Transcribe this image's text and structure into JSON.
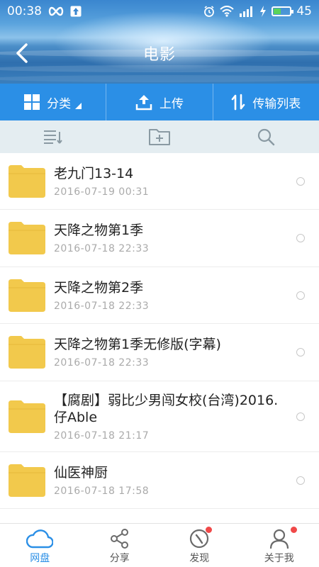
{
  "status_bar": {
    "time": "00:38",
    "battery_level": "45",
    "battery_fraction": 0.45,
    "battery_color": "#5ad35a"
  },
  "header": {
    "title": "电影"
  },
  "action_bar": {
    "category_label": "分类",
    "upload_label": "上传",
    "transfer_label": "传输列表"
  },
  "files": [
    {
      "name": "老九门13-14",
      "date": "2016-07-19   00:31"
    },
    {
      "name": "天降之物第1季",
      "date": "2016-07-18   22:33"
    },
    {
      "name": "天降之物第2季",
      "date": "2016-07-18   22:33"
    },
    {
      "name": "天降之物第1季无修版(字幕)",
      "date": "2016-07-18   22:33"
    },
    {
      "name": "【腐剧】弱比少男闯女校(台湾)2016.仔Able",
      "date": "2016-07-18   21:17"
    },
    {
      "name": "仙医神厨",
      "date": "2016-07-18   17:58"
    }
  ],
  "bottom_nav": [
    {
      "label": "网盘",
      "icon": "cloud-icon",
      "active": true
    },
    {
      "label": "分享",
      "icon": "share-icon",
      "active": false
    },
    {
      "label": "发现",
      "icon": "compass-icon",
      "active": false,
      "badge": true
    },
    {
      "label": "关于我",
      "icon": "person-icon",
      "active": false,
      "badge": true
    }
  ],
  "colors": {
    "accent": "#2b8fe6",
    "folder": "#f2c94c",
    "badge": "#f04848"
  }
}
